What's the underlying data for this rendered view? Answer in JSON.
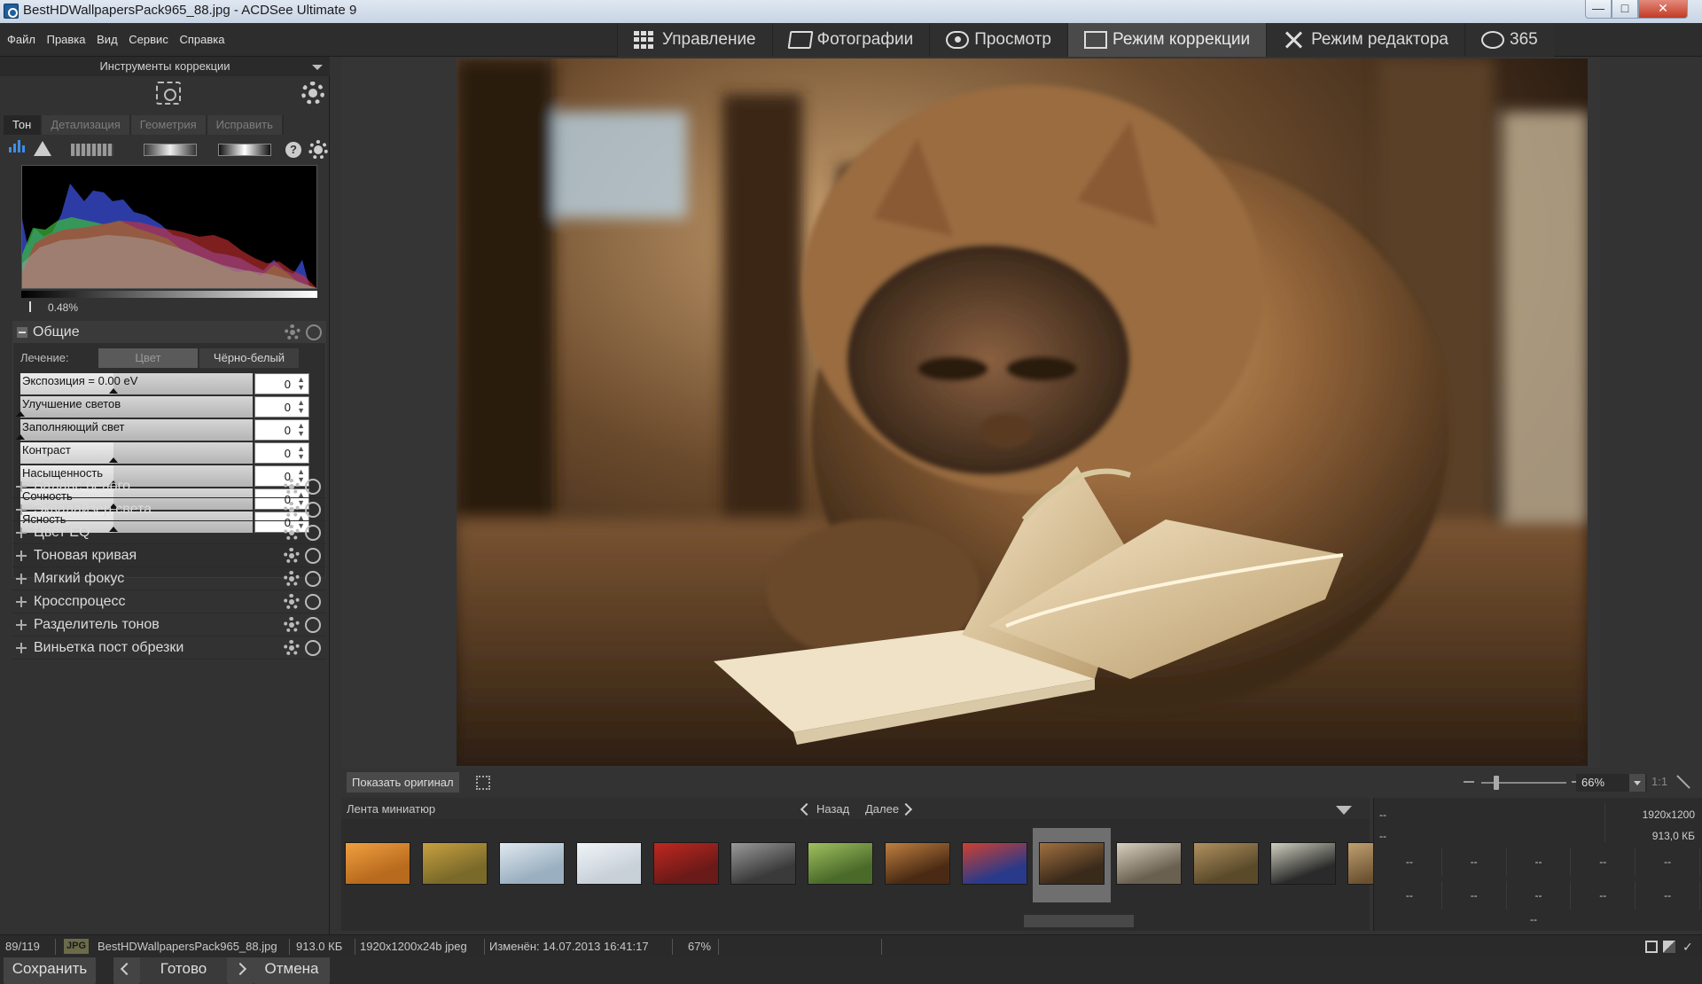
{
  "window": {
    "title": "BestHDWallpapersPack965_88.jpg - ACDSee Ultimate 9",
    "minimize": "—",
    "maximize": "□",
    "close": "✕"
  },
  "menu": [
    "Файл",
    "Правка",
    "Вид",
    "Сервис",
    "Справка"
  ],
  "modes": [
    {
      "label": "Управление",
      "icon": "grid-icon",
      "active": false
    },
    {
      "label": "Фотографии",
      "icon": "photos-icon",
      "active": false
    },
    {
      "label": "Просмотр",
      "icon": "eye-icon",
      "active": false
    },
    {
      "label": "Режим коррекции",
      "icon": "develop-icon",
      "active": true
    },
    {
      "label": "Режим редактора",
      "icon": "edit-tools-icon",
      "active": false
    },
    {
      "label": "365",
      "icon": "acdsee-365-icon",
      "active": false
    }
  ],
  "left_panel": {
    "header": "Инструменты коррекции",
    "tabs": [
      {
        "label": "Тон",
        "active": true
      },
      {
        "label": "Детализация",
        "active": false
      },
      {
        "label": "Геометрия",
        "active": false
      },
      {
        "label": "Исправить",
        "active": false
      }
    ],
    "histogram_readout": "0.48%",
    "general": {
      "title": "Общие",
      "treatment_label": "Лечение:",
      "treatment_options": [
        "Цвет",
        "Чёрно-белый"
      ],
      "treatment_selected": "Цвет",
      "sliders": [
        {
          "label": "Экспозиция = 0.00 eV",
          "value": "0",
          "level": 0.4
        },
        {
          "label": "Улучшение светов",
          "value": "0",
          "level": 0.0
        },
        {
          "label": "Заполняющий свет",
          "value": "0",
          "level": 0.0
        },
        {
          "label": "Контраст",
          "value": "0",
          "level": 0.4
        },
        {
          "label": "Насыщенность",
          "value": "0",
          "level": 0.4
        },
        {
          "label": "Сочность",
          "value": "0",
          "level": 0.4
        },
        {
          "label": "Ясность",
          "value": "0",
          "level": 0.4
        }
      ]
    },
    "sections": [
      "Баланс белого",
      "Эквалайзер света",
      "Цвет EQ",
      "Тоновая кривая",
      "Мягкий фокус",
      "Кросспроцесс",
      "Разделитель тонов",
      "Виньетка пост обрезки"
    ],
    "buttons": {
      "save": "Сохранить",
      "done": "Готово",
      "cancel": "Отмена"
    }
  },
  "viewer": {
    "show_original": "Показать оригинал",
    "zoom": "66%",
    "one_to_one": "1:1"
  },
  "filmstrip": {
    "title": "Лента миниатюр",
    "back": "Назад",
    "forward": "Далее",
    "selected_index": 9,
    "thumb_colors": [
      [
        "#b86a1e",
        "#f0a040"
      ],
      [
        "#7a6a2a",
        "#c8a040"
      ],
      [
        "#9ab0c0",
        "#e0e8f0"
      ],
      [
        "#c8d0d8",
        "#f0f4f8"
      ],
      [
        "#6a1a18",
        "#c02820"
      ],
      [
        "#3a3a3a",
        "#9a9a9a"
      ],
      [
        "#4a6a2a",
        "#a0c060"
      ],
      [
        "#4a2a14",
        "#c08040"
      ],
      [
        "#2a3a8a",
        "#d04030"
      ],
      [
        "#3a2a1a",
        "#a07040"
      ],
      [
        "#6a6050",
        "#d8d0c0"
      ],
      [
        "#5a4a2a",
        "#b09060"
      ],
      [
        "#2a2a2a",
        "#d0d0c0"
      ],
      [
        "#6a5030",
        "#c0a070"
      ]
    ]
  },
  "info": {
    "top_left_1": "--",
    "top_left_2": "--",
    "dims": "1920x1200",
    "size": "913,0 КБ",
    "grid_row1": [
      "--",
      "--",
      "--",
      "--",
      "--"
    ],
    "grid_row2": [
      "--",
      "--",
      "--",
      "--",
      "--"
    ],
    "bottom": "--"
  },
  "status": {
    "position": "89/119",
    "type_badge": "JPG",
    "filename": "BestHDWallpapersPack965_88.jpg",
    "filesize": "913.0 КБ",
    "format": "1920x1200x24b jpeg",
    "modified": "Изменён: 14.07.2013 16:41:17",
    "zoom": "67%"
  }
}
